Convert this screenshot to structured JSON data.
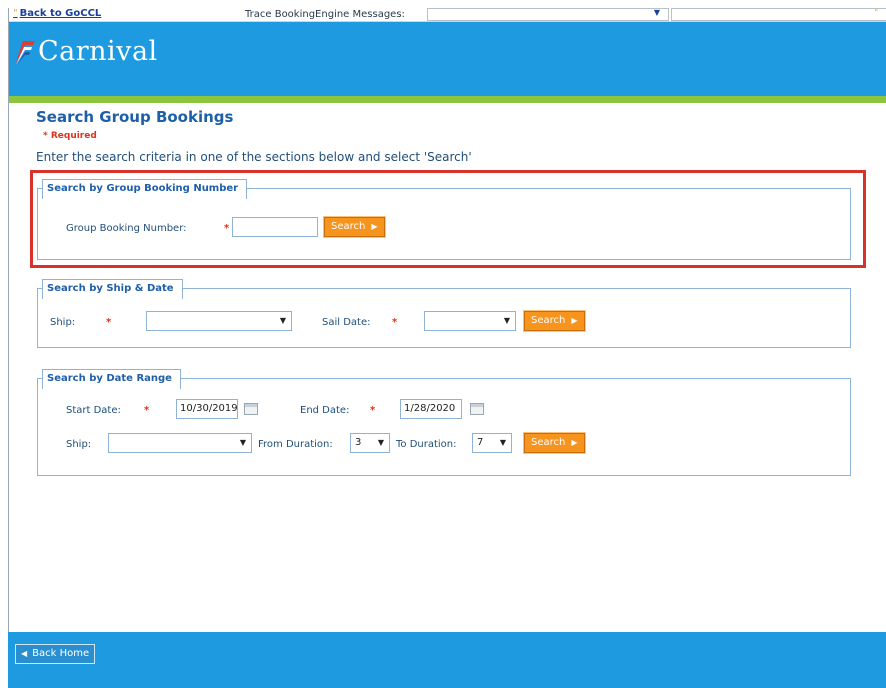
{
  "topbar": {
    "back_link": "Back to GoCCL",
    "trace_label": "Trace BookingEngine Messages:",
    "trace_value": ""
  },
  "header": {
    "logo_text": "Carnival",
    "brand_color": "#1e9be0",
    "accent_color": "#8cc63f"
  },
  "page": {
    "title": "Search Group Bookings",
    "required_note": "* Required",
    "instructions": "Enter the search criteria in one of the sections below and select 'Search'"
  },
  "section_group_number": {
    "legend": "Search by Group Booking Number",
    "field_label": "Group Booking Number:",
    "required_mark": "*",
    "value": "",
    "search_label": "Search"
  },
  "section_ship_date": {
    "legend": "Search by Ship & Date",
    "ship_label": "Ship:",
    "ship_required": "*",
    "ship_value": "",
    "sail_date_label": "Sail Date:",
    "sail_date_required": "*",
    "sail_date_value": "",
    "search_label": "Search"
  },
  "section_date_range": {
    "legend": "Search by Date Range",
    "start_label": "Start Date:",
    "start_required": "*",
    "start_value": "10/30/2019",
    "end_label": "End Date:",
    "end_required": "*",
    "end_value": "1/28/2020",
    "ship_label": "Ship:",
    "ship_value": "",
    "from_duration_label": "From Duration:",
    "from_duration_value": "3",
    "to_duration_label": "To Duration:",
    "to_duration_value": "7",
    "search_label": "Search"
  },
  "footer": {
    "back_home": "Back Home"
  },
  "icons": {
    "dropdown": "chevron-down-icon",
    "calendar": "calendar-icon",
    "arrow_right": "arrow-right-icon",
    "arrow_left": "arrow-left-icon"
  }
}
